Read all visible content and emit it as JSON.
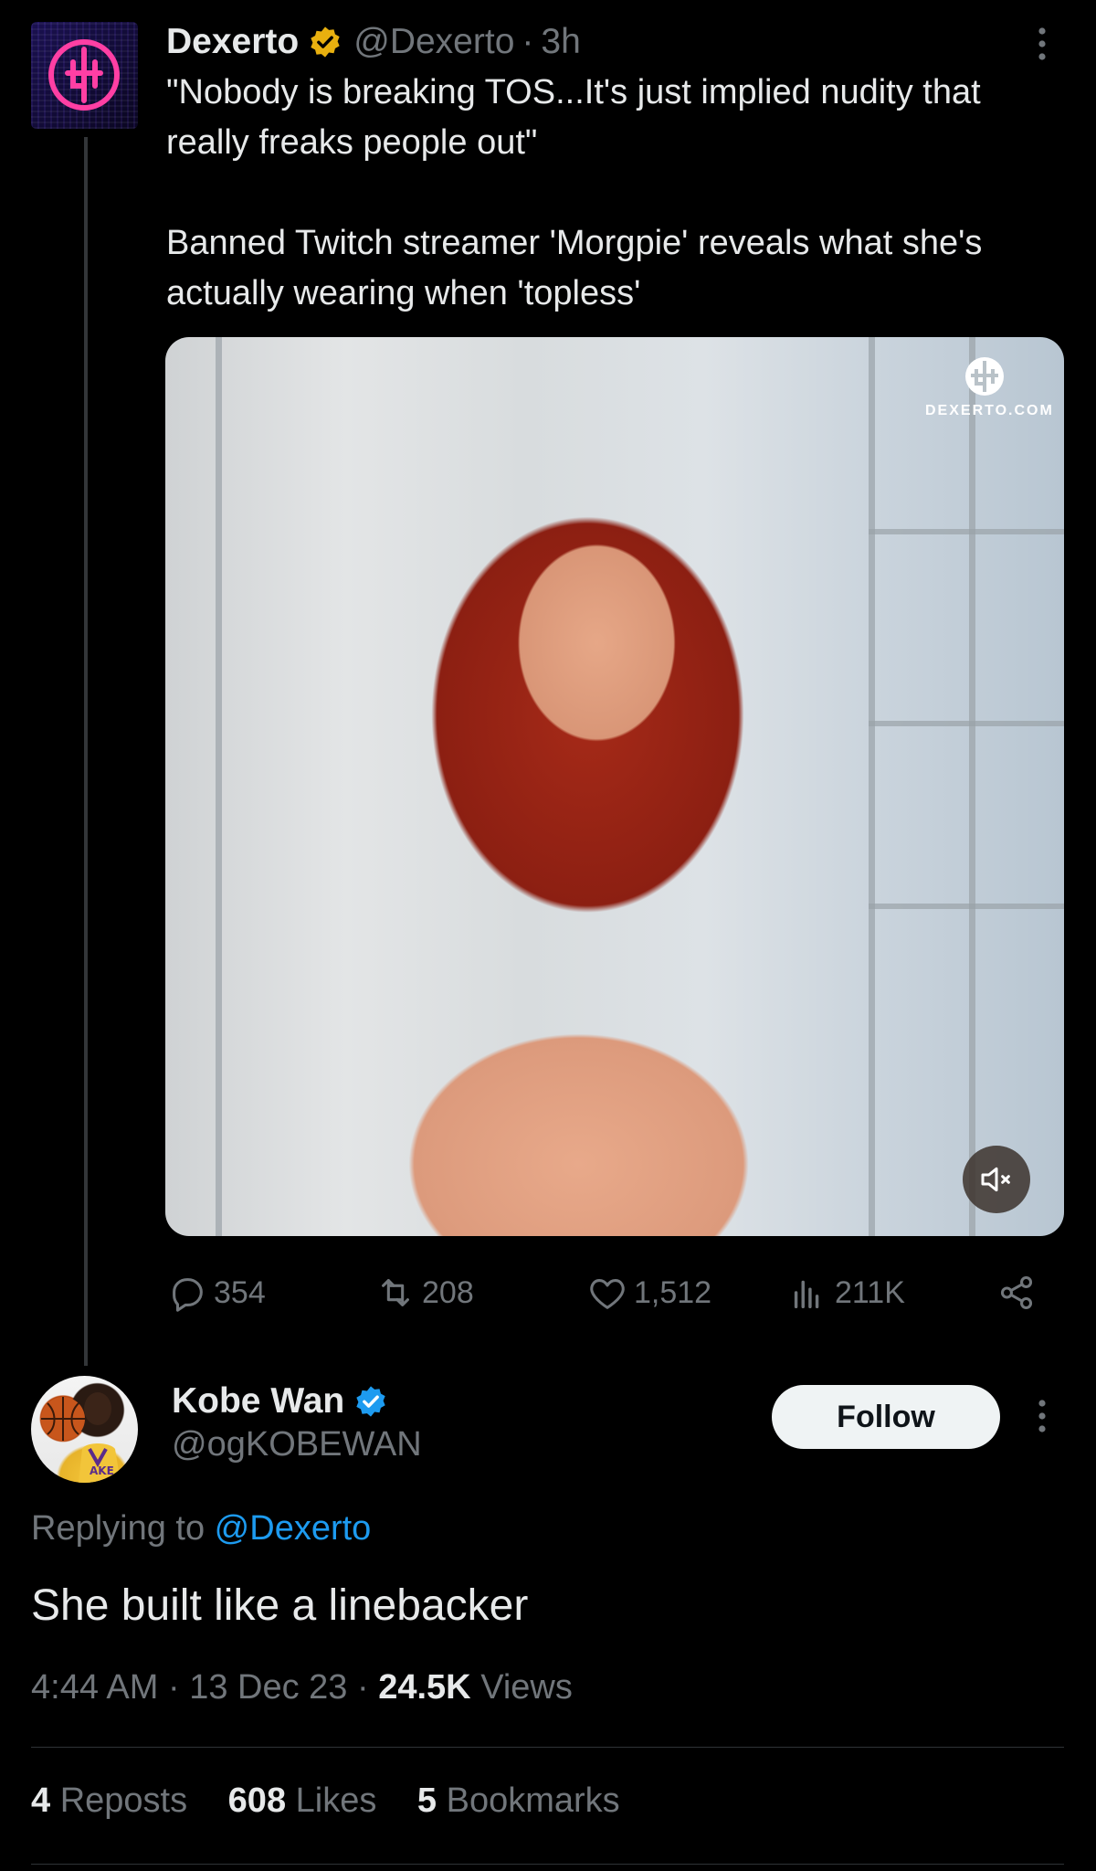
{
  "parent_tweet": {
    "author_name": "Dexerto",
    "handle": "@Dexerto",
    "separator": "·",
    "time": "3h",
    "text_line1": "\"Nobody is breaking TOS...It's just implied nudity that really freaks people out\"",
    "text_line2": "Banned Twitch streamer 'Morgpie' reveals what she's actually wearing when 'topless'",
    "media": {
      "watermark": "DEXERTO.COM"
    },
    "actions": {
      "replies": "354",
      "reposts": "208",
      "likes": "1,512",
      "views": "211K"
    },
    "verified_badge_color": "#e8b00f"
  },
  "reply": {
    "author_name": "Kobe Wan",
    "handle": "@ogKOBEWAN",
    "follow_label": "Follow",
    "replying_prefix": "Replying to ",
    "replying_to": "@Dexerto",
    "text": "She built like a linebacker",
    "time": "4:44 AM",
    "date": "13 Dec 23",
    "views_count": "24.5K",
    "views_label": "Views",
    "separator": "·",
    "stats": {
      "reposts_count": "4",
      "reposts_label": "Reposts",
      "likes_count": "608",
      "likes_label": "Likes",
      "bookmarks_count": "5",
      "bookmarks_label": "Bookmarks"
    },
    "verified_badge_color": "#1d9bf0"
  },
  "colors": {
    "background": "#000000",
    "text": "#e7e9ea",
    "secondary": "#71767b",
    "link": "#1d9bf0"
  }
}
